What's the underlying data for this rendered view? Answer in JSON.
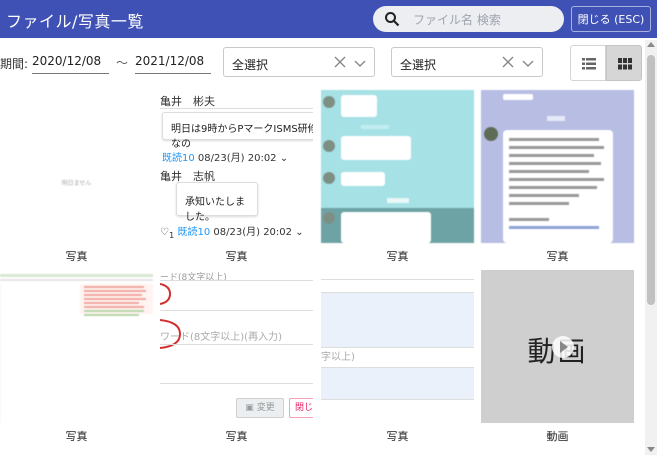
{
  "header": {
    "title": "ファイル/写真一覧",
    "search_placeholder": "ファイル名 検索",
    "close_label": "閉じる (ESC)"
  },
  "filters": {
    "period_label": "期間:",
    "date_from": "2020/12/08",
    "separator": "～",
    "date_to": "2021/12/08",
    "select1_value": "全選択",
    "select2_value": "全選択"
  },
  "colors": {
    "header_bg": "#3f51b5",
    "read_blue": "#2196f3",
    "tile_cyan": "#a6e1e6",
    "tile_purple": "#b7bde3"
  },
  "tiles": [
    {
      "caption": "写真",
      "thumb_text": "明日ません"
    },
    {
      "caption": "写真",
      "chat": {
        "name1": "亀井　彬夫",
        "message1": "明日は9時からPマークISMS研修なの",
        "read1": "既読10",
        "time1": "08/23(月) 20:02",
        "name2": "亀井　志帆",
        "message2": "承知いたしました。",
        "like_count": "1",
        "read2": "既読10",
        "time2": "08/23(月) 20:02"
      }
    },
    {
      "caption": "写真"
    },
    {
      "caption": "写真"
    },
    {
      "caption": "写真"
    },
    {
      "caption": "写真",
      "form": {
        "label1": "ード(8文字以上)",
        "label2": "ワード(8文字以上)(再入力)",
        "change_button": "変更",
        "close_button": "閉じ"
      }
    },
    {
      "caption": "写真",
      "form_text": "字以上)"
    },
    {
      "caption": "動画",
      "video_text": "動画"
    }
  ]
}
